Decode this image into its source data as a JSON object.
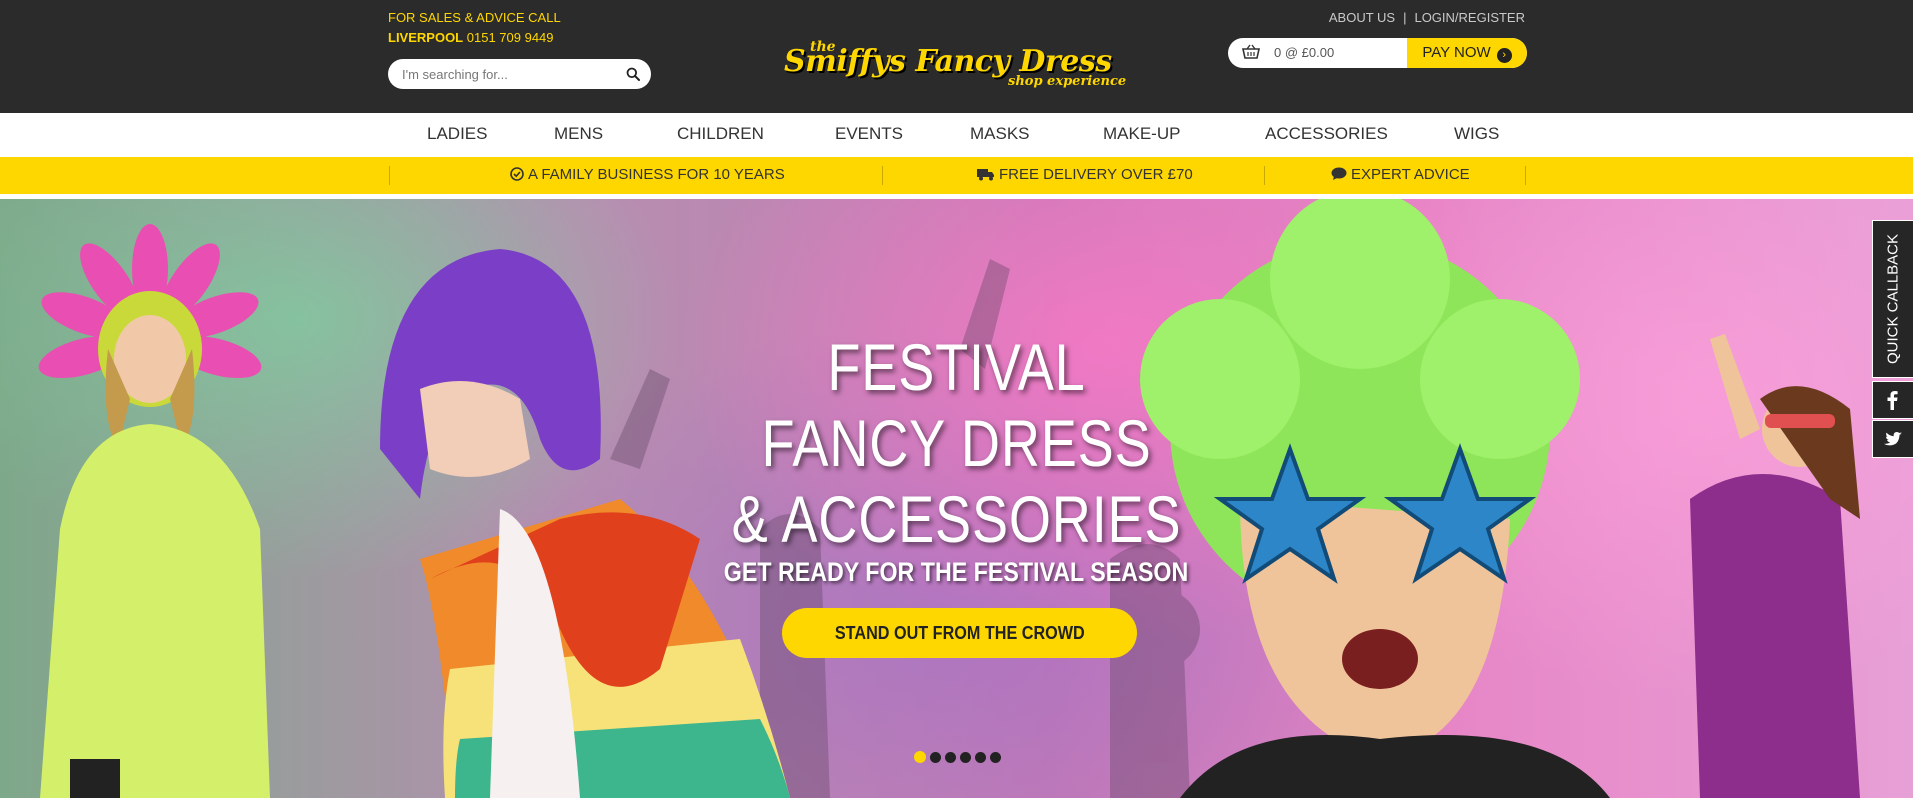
{
  "header": {
    "sales_line1": "FOR SALES & ADVICE CALL",
    "sales_city": "LIVERPOOL",
    "sales_phone": "0151 709 9449",
    "search_placeholder": "I'm searching for...",
    "logo_the": "the",
    "logo_name": "Smiffys Fancy Dress",
    "logo_tagline": "shop experience",
    "about_label": "ABOUT US",
    "login_label": "LOGIN/REGISTER",
    "link_separator": "|",
    "cart_summary": "0 @ £0.00",
    "pay_label": "PAY NOW",
    "pay_arrow": "›"
  },
  "nav": {
    "items": [
      "LADIES",
      "MENS",
      "CHILDREN",
      "EVENTS",
      "MASKS",
      "MAKE-UP",
      "ACCESSORIES",
      "WIGS"
    ]
  },
  "usp": {
    "items": [
      "A FAMILY BUSINESS FOR 10 YEARS",
      "FREE DELIVERY OVER £70",
      "EXPERT ADVICE"
    ]
  },
  "hero": {
    "headline": [
      "FESTIVAL",
      "FANCY DRESS",
      "& ACCESSORIES"
    ],
    "subheadline": "GET READY FOR THE FESTIVAL SEASON",
    "cta_label": "STAND OUT FROM THE CROWD",
    "slide_count": 6,
    "active_slide": 1
  },
  "side": {
    "callback_label": "QUICK CALLBACK",
    "facebook_icon": "facebook-icon",
    "twitter_icon": "twitter-icon"
  },
  "colors": {
    "brand_yellow": "#ffd700",
    "topbar": "#2b2b2b",
    "text_dark": "#333333"
  }
}
